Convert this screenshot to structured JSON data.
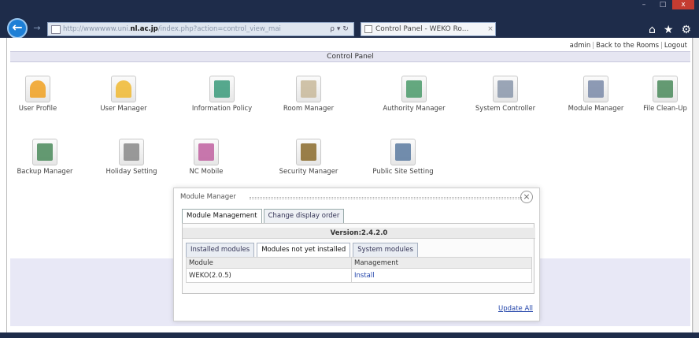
{
  "browser": {
    "window_controls": [
      "–",
      "□",
      "x"
    ],
    "back_symbol": "←",
    "forward_symbol": "→",
    "url_prefix": "http://wwwwww.uni.",
    "url_domain": "nl.ac.jp",
    "url_suffix": "/index.php?action=control_view_mai",
    "address_icons": "ρ ▾ ↻",
    "tab_title": "Control Panel - WEKO Ro...",
    "tab_close": "×",
    "tools": [
      "⌂",
      "★",
      "⚙"
    ]
  },
  "page": {
    "top_links": [
      "admin",
      "Back to the Rooms",
      "Logout"
    ],
    "header": "Control Panel"
  },
  "icons": [
    {
      "label": "User Profile",
      "icon": "user-profile-icon",
      "color": "#f0a020"
    },
    {
      "label": "User Manager",
      "icon": "user-manager-icon",
      "color": "#f0b830"
    },
    {
      "label": "Information Policy",
      "icon": "information-policy-icon",
      "color": "#3a9a7a"
    },
    {
      "label": "Room Manager",
      "icon": "room-manager-icon",
      "color": "#c8b89a"
    },
    {
      "label": "Authority Manager",
      "icon": "authority-manager-icon",
      "color": "#4a9a6a"
    },
    {
      "label": "System Controller",
      "icon": "system-controller-icon",
      "color": "#8a96aa"
    },
    {
      "label": "Module Manager",
      "icon": "module-manager-icon",
      "color": "#7a8aa8"
    },
    {
      "label": "File Clean-Up",
      "icon": "file-cleanup-icon",
      "color": "#4a8a5a"
    },
    {
      "label": "Backup Manager",
      "icon": "backup-manager-icon",
      "color": "#4a8a5a"
    },
    {
      "label": "Holiday Setting",
      "icon": "holiday-setting-icon",
      "color": "#888888"
    },
    {
      "label": "NC Mobile",
      "icon": "nc-mobile-icon",
      "color": "#c060a0"
    },
    {
      "label": "Security Manager",
      "icon": "security-manager-icon",
      "color": "#8a6a2a"
    },
    {
      "label": "Public Site Setting",
      "icon": "public-site-setting-icon",
      "color": "#5a7aa0"
    }
  ],
  "dialog": {
    "title": "Module Manager",
    "close_symbol": "×",
    "tabs": [
      "Module Management",
      "Change display order"
    ],
    "version": "Version:2.4.2.0",
    "sub_tabs": [
      "Installed modules",
      "Modules not yet installed",
      "System modules"
    ],
    "table": {
      "headers": [
        "Module",
        "Management"
      ],
      "rows": [
        {
          "module": "WEKO(2.0.5)",
          "action": "Install"
        }
      ]
    },
    "update_all": "Update All"
  }
}
